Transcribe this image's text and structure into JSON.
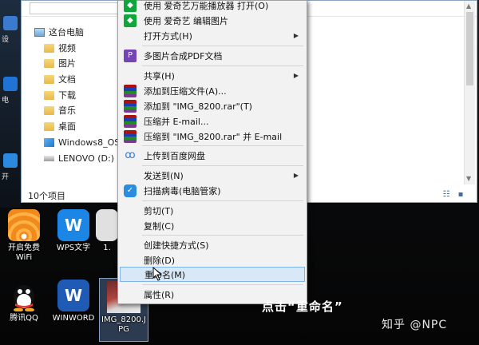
{
  "explorer": {
    "nav": [
      {
        "label": "这台电脑",
        "icon": "computer-icon"
      },
      {
        "label": "视频",
        "icon": "folder-icon"
      },
      {
        "label": "图片",
        "icon": "folder-icon"
      },
      {
        "label": "文档",
        "icon": "folder-icon"
      },
      {
        "label": "下载",
        "icon": "folder-icon"
      },
      {
        "label": "音乐",
        "icon": "folder-icon"
      },
      {
        "label": "桌面",
        "icon": "folder-icon"
      },
      {
        "label": "Windows8_OS (",
        "icon": "windows-drive-icon"
      },
      {
        "label": "LENOVO (D:)",
        "icon": "drive-icon"
      }
    ],
    "item_count": "10个项目",
    "accent": "#3d6fa6"
  },
  "desktop": {
    "left_labels": [
      "设",
      "电",
      "开"
    ],
    "icons": [
      {
        "label": "开启免费WiFi",
        "icon": "wifi-icon"
      },
      {
        "label": "WPS文字",
        "icon": "wps-icon"
      },
      {
        "label": "1.",
        "icon": "file-icon"
      },
      {
        "label": "腾讯QQ",
        "icon": "qq-icon"
      },
      {
        "label": "WINWORD",
        "icon": "word-icon"
      },
      {
        "label": "IMG_8200.JPG",
        "icon": "image-file-icon"
      }
    ]
  },
  "context_menu": {
    "items": [
      {
        "label": "使用 爱奇艺万能播放器 打开(O)",
        "icon": "iqiyi-icon"
      },
      {
        "label": "使用 爱奇艺 编辑图片",
        "icon": "iqiyi-icon"
      },
      {
        "label": "打开方式(H)",
        "icon": "",
        "submenu": "▶"
      },
      {
        "label": "多图片合成PDF文档",
        "icon": "pdf-icon"
      },
      {
        "label": "共享(H)",
        "icon": "",
        "submenu": "▶"
      },
      {
        "label": "添加到压缩文件(A)...",
        "icon": "winrar-icon"
      },
      {
        "label": "添加到 \"IMG_8200.rar\"(T)",
        "icon": "winrar-icon"
      },
      {
        "label": "压缩并 E-mail...",
        "icon": "winrar-icon"
      },
      {
        "label": "压缩到 \"IMG_8200.rar\" 并 E-mail",
        "icon": "winrar-icon"
      },
      {
        "label": "上传到百度网盘",
        "icon": "baidu-netdisk-icon"
      },
      {
        "label": "发送到(N)",
        "icon": "",
        "submenu": "▶"
      },
      {
        "label": "扫描病毒(电脑管家)",
        "icon": "shield-icon"
      },
      {
        "label": "剪切(T)",
        "icon": ""
      },
      {
        "label": "复制(C)",
        "icon": ""
      },
      {
        "label": "创建快捷方式(S)",
        "icon": ""
      },
      {
        "label": "删除(D)",
        "icon": ""
      },
      {
        "label": "重命名(M)",
        "icon": "",
        "highlighted": true
      },
      {
        "label": "属性(R)",
        "icon": ""
      }
    ],
    "highlight_color": "#d9e8f7"
  },
  "overlay": {
    "caption": "点击“重命名”",
    "watermark": "知乎 @NPC"
  }
}
